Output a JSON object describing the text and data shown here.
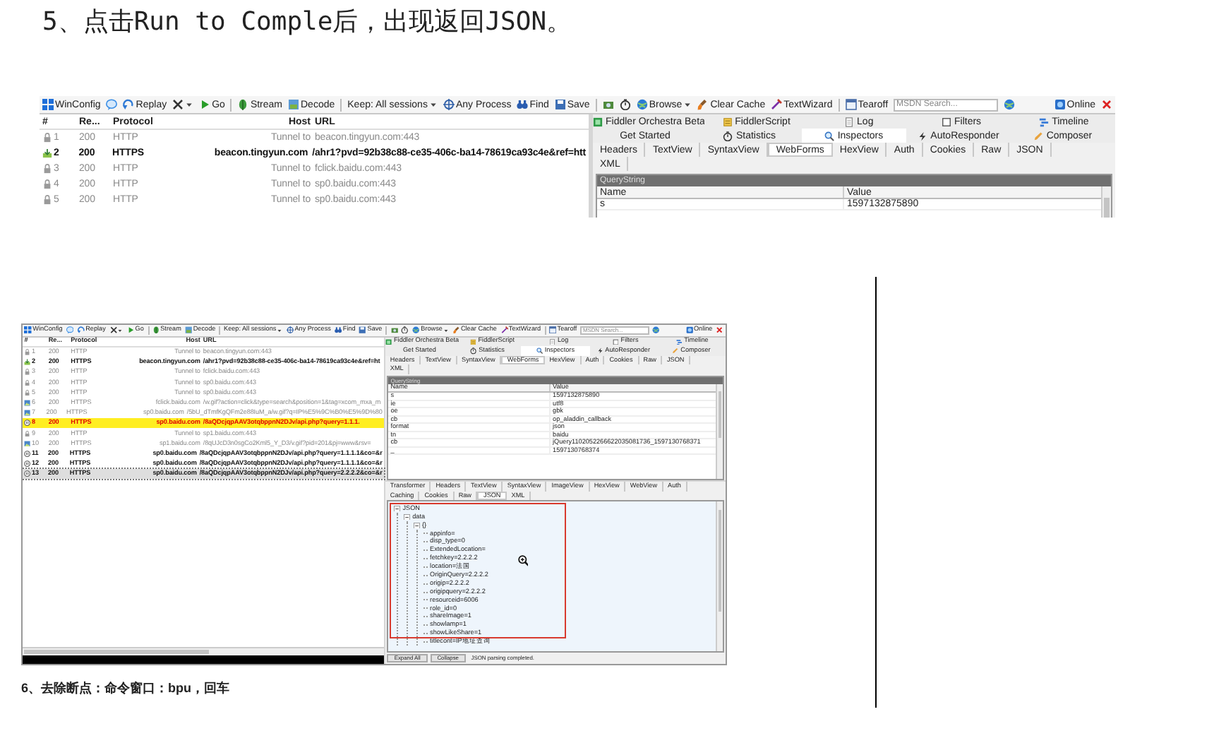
{
  "heading": "5、点击Run to Comple后，出现返回JSON。",
  "screenshots": [
    {
      "toolbar": [
        "WinConfig",
        "Replay",
        "Go",
        "Stream",
        "Decode",
        "Keep: All sessions",
        "Any Process",
        "Find",
        "Save",
        "Browse",
        "Clear Cache",
        "TextWizard",
        "Tearoff"
      ],
      "search": {
        "placeholder": "MSDN Search..."
      },
      "online": "Online",
      "session_columns": [
        "#",
        "Re...",
        "Protocol",
        "Host",
        "URL"
      ],
      "sessions": [
        {
          "number": "1",
          "result": "200",
          "protocol": "HTTP",
          "host": "Tunnel to",
          "url": "beacon.tingyun.com:443",
          "kind": "tunnel",
          "bold": false,
          "marked": false,
          "selected": false
        },
        {
          "number": "2",
          "result": "200",
          "protocol": "HTTPS",
          "host": "beacon.tingyun.com",
          "url": "/ahr1?pvd=92b38c88-ce35-406c-ba14-78619ca93c4e&ref=htt",
          "kind": "response",
          "bold": true,
          "marked": false,
          "selected": false
        },
        {
          "number": "3",
          "result": "200",
          "protocol": "HTTP",
          "host": "Tunnel to",
          "url": "fclick.baidu.com:443",
          "kind": "tunnel",
          "bold": false,
          "marked": false,
          "selected": false
        },
        {
          "number": "4",
          "result": "200",
          "protocol": "HTTP",
          "host": "Tunnel to",
          "url": "sp0.baidu.com:443",
          "kind": "tunnel",
          "bold": false,
          "marked": false,
          "selected": false
        },
        {
          "number": "5",
          "result": "200",
          "protocol": "HTTP",
          "host": "Tunnel to",
          "url": "sp0.baidu.com:443",
          "kind": "tunnel",
          "bold": false,
          "marked": false,
          "selected": false
        }
      ],
      "tab_rows": [
        [
          {
            "label": "Fiddler Orchestra Beta",
            "selected": false
          },
          {
            "label": "FiddlerScript",
            "selected": false
          },
          {
            "label": "Log",
            "selected": false
          },
          {
            "label": "Filters",
            "selected": false
          },
          {
            "label": "Timeline",
            "selected": false
          }
        ],
        [
          {
            "label": "Get Started",
            "selected": false
          },
          {
            "label": "Statistics",
            "selected": false
          },
          {
            "label": "Inspectors",
            "selected": true
          },
          {
            "label": "AutoResponder",
            "selected": false
          },
          {
            "label": "Composer",
            "selected": false
          }
        ]
      ],
      "request_tab_rows": [
        [
          {
            "label": "Headers",
            "selected": false
          },
          {
            "label": "TextView",
            "selected": false
          },
          {
            "label": "SyntaxView",
            "selected": false
          },
          {
            "label": "WebForms",
            "selected": true
          },
          {
            "label": "HexView",
            "selected": false
          },
          {
            "label": "Auth",
            "selected": false
          },
          {
            "label": "Cookies",
            "selected": false
          },
          {
            "label": "Raw",
            "selected": false
          },
          {
            "label": "JSON",
            "selected": false
          }
        ],
        [
          {
            "label": "XML",
            "selected": false
          }
        ]
      ],
      "webforms": {
        "section": "QueryString",
        "columns": [
          "Name",
          "Value"
        ],
        "rows": [
          [
            "s",
            "1597132875890"
          ]
        ]
      }
    },
    {
      "toolbar": [
        "WinConfig",
        "Replay",
        "Go",
        "Stream",
        "Decode",
        "Keep: All sessions",
        "Any Process",
        "Find",
        "Save",
        "Browse",
        "Clear Cache",
        "TextWizard",
        "Tearoff"
      ],
      "search": {
        "placeholder": "MSDN Search..."
      },
      "online": "Online",
      "session_columns": [
        "#",
        "Re...",
        "Protocol",
        "Host",
        "URL"
      ],
      "sessions": [
        {
          "number": "1",
          "result": "200",
          "protocol": "HTTP",
          "host": "Tunnel to",
          "url": "beacon.tingyun.com:443",
          "kind": "tunnel",
          "bold": false,
          "marked": false,
          "selected": false
        },
        {
          "number": "2",
          "result": "200",
          "protocol": "HTTPS",
          "host": "beacon.tingyun.com",
          "url": "/ahr1?pvd=92b38c88-ce35-406c-ba14-78619ca93c4e&ref=ht",
          "kind": "response",
          "bold": true,
          "marked": false,
          "selected": false
        },
        {
          "number": "3",
          "result": "200",
          "protocol": "HTTP",
          "host": "Tunnel to",
          "url": "fclick.baidu.com:443",
          "kind": "tunnel",
          "bold": false,
          "marked": false,
          "selected": false
        },
        {
          "number": "4",
          "result": "200",
          "protocol": "HTTP",
          "host": "Tunnel to",
          "url": "sp0.baidu.com:443",
          "kind": "tunnel",
          "bold": false,
          "marked": false,
          "selected": false
        },
        {
          "number": "5",
          "result": "200",
          "protocol": "HTTP",
          "host": "Tunnel to",
          "url": "sp0.baidu.com:443",
          "kind": "tunnel",
          "bold": false,
          "marked": false,
          "selected": false
        },
        {
          "number": "6",
          "result": "200",
          "protocol": "HTTPS",
          "host": "fclick.baidu.com",
          "url": "/w.gif?action=click&type=search&position=1&tag=xcom_mxa_m",
          "kind": "image",
          "bold": false,
          "marked": false,
          "selected": false
        },
        {
          "number": "7",
          "result": "200",
          "protocol": "HTTPS",
          "host": "sp0.baidu.com",
          "url": "/5bU_dTmfKgQFm2e88IuM_a/w.gif?q=IP%E5%9C%B0%E5%9D%80",
          "kind": "image",
          "bold": false,
          "marked": false,
          "selected": false
        },
        {
          "number": "8",
          "result": "200",
          "protocol": "HTTPS",
          "host": "sp0.baidu.com",
          "url": "/8aQDcjqpAAV3otqbppnN2DJv/api.php?query=1.1.1.",
          "kind": "breakpoint",
          "bold": true,
          "marked": true,
          "selected": false
        },
        {
          "number": "9",
          "result": "200",
          "protocol": "HTTP",
          "host": "Tunnel to",
          "url": "sp1.baidu.com:443",
          "kind": "tunnel",
          "bold": false,
          "marked": false,
          "selected": false
        },
        {
          "number": "10",
          "result": "200",
          "protocol": "HTTPS",
          "host": "sp1.baidu.com",
          "url": "/8qUJcD3n0sgCo2Kml5_Y_D3/v.gif?pid=201&pj=www&rsv=",
          "kind": "image",
          "bold": false,
          "marked": false,
          "selected": false
        },
        {
          "number": "11",
          "result": "200",
          "protocol": "HTTPS",
          "host": "sp0.baidu.com",
          "url": "/8aQDcjqpAAV3otqbppnN2DJv/api.php?query=1.1.1.1&co=&r",
          "kind": "breakpoint",
          "bold": true,
          "marked": false,
          "selected": false
        },
        {
          "number": "12",
          "result": "200",
          "protocol": "HTTPS",
          "host": "sp0.baidu.com",
          "url": "/8aQDcjqpAAV3otqbppnN2DJv/api.php?query=1.1.1.1&co=&r",
          "kind": "breakpoint",
          "bold": true,
          "marked": false,
          "selected": false
        },
        {
          "number": "13",
          "result": "200",
          "protocol": "HTTPS",
          "host": "sp0.baidu.com",
          "url": "/8aQDcjqpAAV3otqbppnN2DJv/api.php?query=2.2.2.2&co=&r",
          "kind": "breakpoint",
          "bold": true,
          "marked": false,
          "selected": true
        }
      ],
      "tab_rows": [
        [
          {
            "label": "Fiddler Orchestra Beta",
            "selected": false
          },
          {
            "label": "FiddlerScript",
            "selected": false
          },
          {
            "label": "Log",
            "selected": false
          },
          {
            "label": "Filters",
            "selected": false
          },
          {
            "label": "Timeline",
            "selected": false
          }
        ],
        [
          {
            "label": "Get Started",
            "selected": false
          },
          {
            "label": "Statistics",
            "selected": false
          },
          {
            "label": "Inspectors",
            "selected": true
          },
          {
            "label": "AutoResponder",
            "selected": false
          },
          {
            "label": "Composer",
            "selected": false
          }
        ]
      ],
      "request_tab_rows": [
        [
          {
            "label": "Headers",
            "selected": false
          },
          {
            "label": "TextView",
            "selected": false
          },
          {
            "label": "SyntaxView",
            "selected": false
          },
          {
            "label": "WebForms",
            "selected": true
          },
          {
            "label": "HexView",
            "selected": false
          },
          {
            "label": "Auth",
            "selected": false
          },
          {
            "label": "Cookies",
            "selected": false
          },
          {
            "label": "Raw",
            "selected": false
          },
          {
            "label": "JSON",
            "selected": false
          }
        ],
        [
          {
            "label": "XML",
            "selected": false
          }
        ]
      ],
      "webforms": {
        "section": "QueryString",
        "columns": [
          "Name",
          "Value"
        ],
        "rows": [
          [
            "s",
            "1597132875890"
          ],
          [
            "ie",
            "utf8"
          ],
          [
            "oe",
            "gbk"
          ],
          [
            "cb",
            "op_aladdin_callback"
          ],
          [
            "format",
            "json"
          ],
          [
            "tn",
            "baidu"
          ],
          [
            "cb",
            "jQuery110205226662203508173​6_1597130768371"
          ],
          [
            "_",
            "1597130768374"
          ]
        ]
      },
      "response_tab_rows": [
        [
          {
            "label": "Transformer",
            "selected": false
          },
          {
            "label": "Headers",
            "selected": false
          },
          {
            "label": "TextView",
            "selected": false
          },
          {
            "label": "SyntaxView",
            "selected": false
          },
          {
            "label": "ImageView",
            "selected": false
          },
          {
            "label": "HexView",
            "selected": false
          },
          {
            "label": "WebView",
            "selected": false
          },
          {
            "label": "Auth",
            "selected": false
          }
        ],
        [
          {
            "label": "Caching",
            "selected": false
          },
          {
            "label": "Cookies",
            "selected": false
          },
          {
            "label": "Raw",
            "selected": false
          },
          {
            "label": "JSON",
            "selected": true
          },
          {
            "label": "XML",
            "selected": false
          }
        ]
      ],
      "json_tree": [
        {
          "label": "JSON",
          "expanded": true,
          "children": [
            {
              "label": "data",
              "expanded": true,
              "children": [
                {
                  "label": "{}",
                  "expanded": true,
                  "children": [
                    {
                      "label": "appinfo="
                    },
                    {
                      "label": "disp_type=0"
                    },
                    {
                      "label": "ExtendedLocation="
                    },
                    {
                      "label": "fetchkey=2.2.2.2"
                    },
                    {
                      "label": "location=法国"
                    },
                    {
                      "label": "OriginQuery=2.2.2.2"
                    },
                    {
                      "label": "origip=2.2.2.2"
                    },
                    {
                      "label": "origipquery=2.2.2.2"
                    },
                    {
                      "label": "resourceid=6006"
                    },
                    {
                      "label": "role_id=0"
                    },
                    {
                      "label": "shareImage=1"
                    },
                    {
                      "label": "showlamp=1"
                    },
                    {
                      "label": "showLikeShare=1"
                    },
                    {
                      "label": "titlecont=IP地址查询"
                    }
                  ]
                }
              ]
            }
          ]
        }
      ],
      "tree_buttons": [
        "Expand All",
        "Collapse"
      ],
      "tree_status": "JSON parsing completed."
    }
  ],
  "caption": "6、去除断点：命令窗口：bpu，回车"
}
